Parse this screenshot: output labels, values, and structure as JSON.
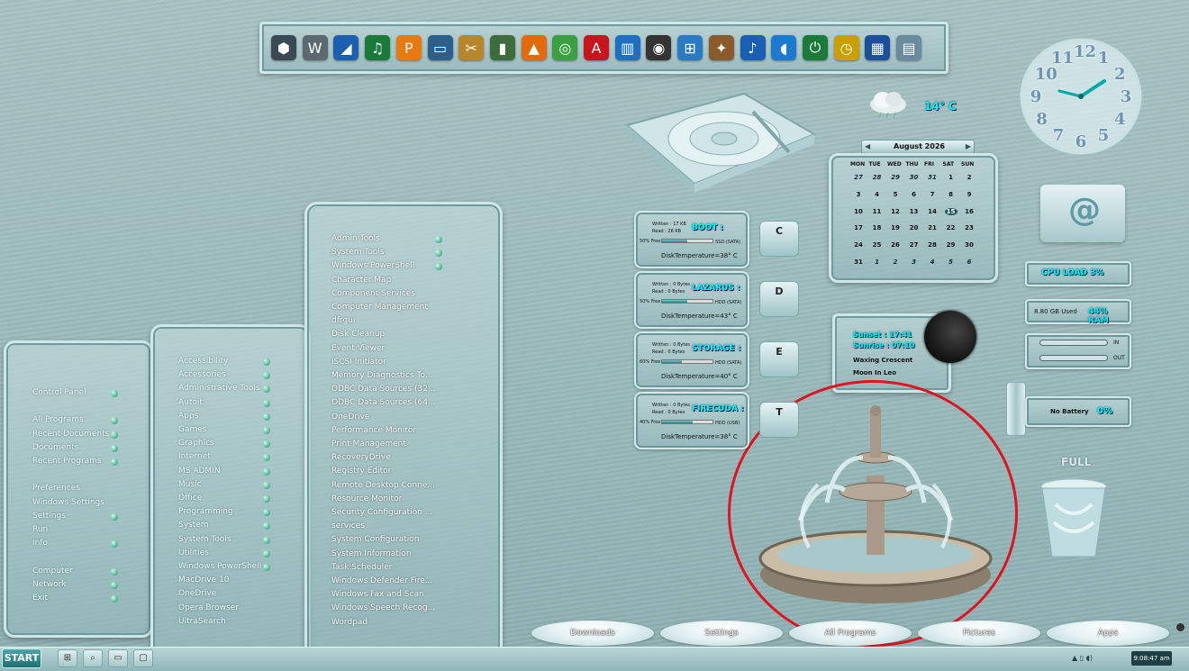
{
  "dock": {
    "icons": [
      {
        "name": "winaero-icon",
        "glyph": "⬢",
        "color": "#3a4a55"
      },
      {
        "name": "w-logo-icon",
        "glyph": "W",
        "color": "#5a6a70"
      },
      {
        "name": "cyberlink-icon",
        "glyph": "◢",
        "color": "#1c5fae"
      },
      {
        "name": "audio-editor-icon",
        "glyph": "♫",
        "color": "#1a7a3a"
      },
      {
        "name": "pdf-tool-icon",
        "glyph": "P",
        "color": "#e87a10"
      },
      {
        "name": "monitor-icon",
        "glyph": "▭",
        "color": "#2b5f8c"
      },
      {
        "name": "media-tool-icon",
        "glyph": "✂",
        "color": "#b8862a"
      },
      {
        "name": "book-icon",
        "glyph": "▮",
        "color": "#3d6d3d"
      },
      {
        "name": "vlc-icon",
        "glyph": "▲",
        "color": "#e26a0a"
      },
      {
        "name": "web-icon",
        "glyph": "◎",
        "color": "#3aa040"
      },
      {
        "name": "acrobat-icon",
        "glyph": "A",
        "color": "#c8141b"
      },
      {
        "name": "reader-icon",
        "glyph": "▥",
        "color": "#1f6fc0"
      },
      {
        "name": "camera-icon",
        "glyph": "◉",
        "color": "#333333"
      },
      {
        "name": "windows-icon",
        "glyph": "⊞",
        "color": "#2b7ac4"
      },
      {
        "name": "tools-icon",
        "glyph": "✦",
        "color": "#8a5a2a"
      },
      {
        "name": "music-note-icon",
        "glyph": "♪",
        "color": "#1a5fb4"
      },
      {
        "name": "speaker-icon",
        "glyph": "◖",
        "color": "#1c7ad0"
      },
      {
        "name": "power-icon",
        "glyph": "⏻",
        "color": "#1a7a3a"
      },
      {
        "name": "alarm-clock-icon",
        "glyph": "◷",
        "color": "#c9a000"
      },
      {
        "name": "paint-icon",
        "glyph": "▦",
        "color": "#1b4f9c"
      },
      {
        "name": "printer-icon",
        "glyph": "▤",
        "color": "#6a8aa0"
      }
    ]
  },
  "weather": {
    "temp": "14° C"
  },
  "clock": {
    "numbers": [
      "12",
      "1",
      "2",
      "3",
      "4",
      "5",
      "6",
      "7",
      "8",
      "9",
      "10",
      "11"
    ]
  },
  "calendar": {
    "month": "August 2026",
    "prev": "◀",
    "next": "▶",
    "days_header": [
      "MON",
      "TUE",
      "WED",
      "THU",
      "FRI",
      "SAT",
      "SUN"
    ],
    "weeks": [
      [
        "27",
        "28",
        "29",
        "30",
        "31",
        "1",
        "2"
      ],
      [
        "3",
        "4",
        "5",
        "6",
        "7",
        "8",
        "9"
      ],
      [
        "10",
        "11",
        "12",
        "13",
        "14",
        "15",
        "16"
      ],
      [
        "17",
        "18",
        "19",
        "20",
        "21",
        "22",
        "23"
      ],
      [
        "24",
        "25",
        "26",
        "27",
        "28",
        "29",
        "30"
      ],
      [
        "31",
        "1",
        "2",
        "3",
        "4",
        "5",
        "6"
      ]
    ],
    "today": "15"
  },
  "email": {
    "symbol": "@"
  },
  "cpu": {
    "label": "CPU LOAD 3%"
  },
  "ram": {
    "used": "8.80 GB Used",
    "pct": "44% RAM"
  },
  "network": {
    "in_label": "IN",
    "out_label": "OUT"
  },
  "battery": {
    "status": "No Battery",
    "pct": "0%"
  },
  "astro": {
    "sunset": "Sunset : 17:41",
    "sunrise": "Sunrise : 07:10",
    "phase": "Waxing Crescent",
    "moon_sign": "Moon In Leo"
  },
  "recycle_bin": {
    "label": "FULL"
  },
  "drives": [
    {
      "name": "BOOT :",
      "letter": "C",
      "written": "Written : 17 KB",
      "read": "Read : 28 KB",
      "free": "50% Free",
      "type": "SSD (SATA)",
      "temp": "DiskTemperature=38° C",
      "fill": 0.5
    },
    {
      "name": "LAZARUS :",
      "letter": "D",
      "written": "Written : 0 Bytes",
      "read": "Read : 0 Bytes",
      "free": "50% Free",
      "type": "HDD (SATA)",
      "temp": "DiskTemperature=43° C",
      "fill": 0.5
    },
    {
      "name": "STORAGE :",
      "letter": "E",
      "written": "Written : 0 Bytes",
      "read": "Read : 0 Bytes",
      "free": "60% Free",
      "type": "HDD (SATA)",
      "temp": "DiskTemperature=40° C",
      "fill": 0.4
    },
    {
      "name": "FIRECUDA :",
      "letter": "T",
      "written": "Written : 0 Bytes",
      "read": "Read : 0 Bytes",
      "free": "40% Free",
      "type": "HDD (USB)",
      "temp": "DiskTemperature=38° C",
      "fill": 0.6
    }
  ],
  "menu1": {
    "items": [
      {
        "label": "Control Panel",
        "arrow": true
      },
      {
        "label": "",
        "arrow": false
      },
      {
        "label": "All Programs",
        "arrow": true
      },
      {
        "label": "Recent Documents",
        "arrow": true
      },
      {
        "label": "Documents",
        "arrow": true
      },
      {
        "label": "Recent Programs",
        "arrow": true
      },
      {
        "label": "",
        "arrow": false
      },
      {
        "label": "Preferences",
        "arrow": false
      },
      {
        "label": "Windows Settings",
        "arrow": false
      },
      {
        "label": "Settings",
        "arrow": true
      },
      {
        "label": "Run",
        "arrow": false
      },
      {
        "label": "Info",
        "arrow": true
      },
      {
        "label": "",
        "arrow": false
      },
      {
        "label": "Computer",
        "arrow": true
      },
      {
        "label": "Network",
        "arrow": true
      },
      {
        "label": "Exit",
        "arrow": true
      }
    ]
  },
  "menu2": {
    "items": [
      {
        "label": "Accessibility",
        "arrow": true
      },
      {
        "label": "Accessories",
        "arrow": true
      },
      {
        "label": "Administrative Tools",
        "arrow": true
      },
      {
        "label": "Autoit",
        "arrow": true
      },
      {
        "label": "Apps",
        "arrow": true
      },
      {
        "label": "Games",
        "arrow": true
      },
      {
        "label": "Graphics",
        "arrow": true
      },
      {
        "label": "Internet",
        "arrow": true
      },
      {
        "label": "MS ADMIN",
        "arrow": true
      },
      {
        "label": "Music",
        "arrow": true
      },
      {
        "label": "Office",
        "arrow": true
      },
      {
        "label": "Programming",
        "arrow": true
      },
      {
        "label": "System",
        "arrow": true
      },
      {
        "label": "System Tools",
        "arrow": true
      },
      {
        "label": "Utilities",
        "arrow": true
      },
      {
        "label": "Windows PowerShell",
        "arrow": true
      },
      {
        "label": "MacDrive 10",
        "arrow": false
      },
      {
        "label": "OneDrive",
        "arrow": false
      },
      {
        "label": "Opera Browser",
        "arrow": false
      },
      {
        "label": "UltraSearch",
        "arrow": false
      }
    ]
  },
  "menu3": {
    "items": [
      {
        "label": "Admin Tools",
        "arrow": true
      },
      {
        "label": "System Tools",
        "arrow": true
      },
      {
        "label": "Windows PowerShell",
        "arrow": true
      },
      {
        "label": "Character Map",
        "arrow": false
      },
      {
        "label": "Component Services",
        "arrow": false
      },
      {
        "label": "Computer Management",
        "arrow": false
      },
      {
        "label": "dfrgui",
        "arrow": false
      },
      {
        "label": "Disk Cleanup",
        "arrow": false
      },
      {
        "label": "Event Viewer",
        "arrow": false
      },
      {
        "label": "iSCSI Initiator",
        "arrow": false
      },
      {
        "label": "Memory Diagnostics To...",
        "arrow": false
      },
      {
        "label": "ODBC Data Sources (32...",
        "arrow": false
      },
      {
        "label": "ODBC Data Sources (64...",
        "arrow": false
      },
      {
        "label": "OneDrive",
        "arrow": false
      },
      {
        "label": "Performance Monitor",
        "arrow": false
      },
      {
        "label": "Print Management",
        "arrow": false
      },
      {
        "label": "RecoveryDrive",
        "arrow": false
      },
      {
        "label": "Registry Editor",
        "arrow": false
      },
      {
        "label": "Remote Desktop Conne...",
        "arrow": false
      },
      {
        "label": "Resource Monitor",
        "arrow": false
      },
      {
        "label": "Security Configuration ...",
        "arrow": false
      },
      {
        "label": "services",
        "arrow": false
      },
      {
        "label": "System Configuration",
        "arrow": false
      },
      {
        "label": "System Information",
        "arrow": false
      },
      {
        "label": "Task Scheduler",
        "arrow": false
      },
      {
        "label": "Windows Defender Fire...",
        "arrow": false
      },
      {
        "label": "Windows Fax and Scan",
        "arrow": false
      },
      {
        "label": "Windows Speech Recog...",
        "arrow": false
      },
      {
        "label": "Wordpad",
        "arrow": false
      }
    ]
  },
  "shortcut_bar": [
    "Downloads",
    "Settings",
    "All Programs",
    "Pictures",
    "Apps"
  ],
  "taskbar": {
    "start": "START",
    "time": "9:08:47 am"
  }
}
